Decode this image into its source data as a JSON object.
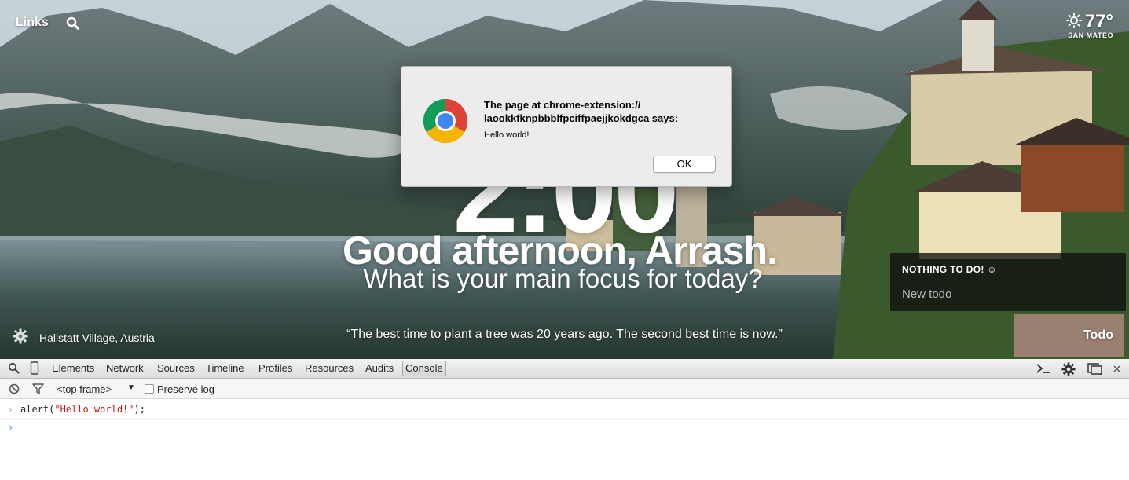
{
  "momentum": {
    "links_label": "Links",
    "weather": {
      "temperature": "77°",
      "location": "SAN MATEO"
    },
    "clock": "2:00",
    "greeting": "Good afternoon, Arrash.",
    "focus_prompt": "What is your main focus for today?",
    "photo_location": "Hallstatt Village, Austria",
    "quote": "“The best time to plant a tree was 20 years ago. The second best time is now.”",
    "todo": {
      "empty_state": "NOTHING TO DO! ☺",
      "new_placeholder": "New todo",
      "link_label": "Todo"
    }
  },
  "alert": {
    "title_line1": "The page at chrome-extension://",
    "title_line2": "laookkfknpbbblfpciffpaejjkokdgca says:",
    "message": "Hello world!",
    "ok_label": "OK"
  },
  "devtools": {
    "tabs": [
      "Elements",
      "Network",
      "Sources",
      "Timeline",
      "Profiles",
      "Resources",
      "Audits",
      "Console"
    ],
    "active_tab": "Console",
    "frame_select": "<top frame>",
    "preserve_log_label": "Preserve log",
    "preserve_log_checked": false,
    "console_history": [
      {
        "code_prefix": "alert(",
        "code_string": "\"Hello world!\"",
        "code_suffix": ");"
      }
    ]
  },
  "colors": {
    "console_string": "#c41a16",
    "prompt_blue": "#3b7ad8"
  }
}
